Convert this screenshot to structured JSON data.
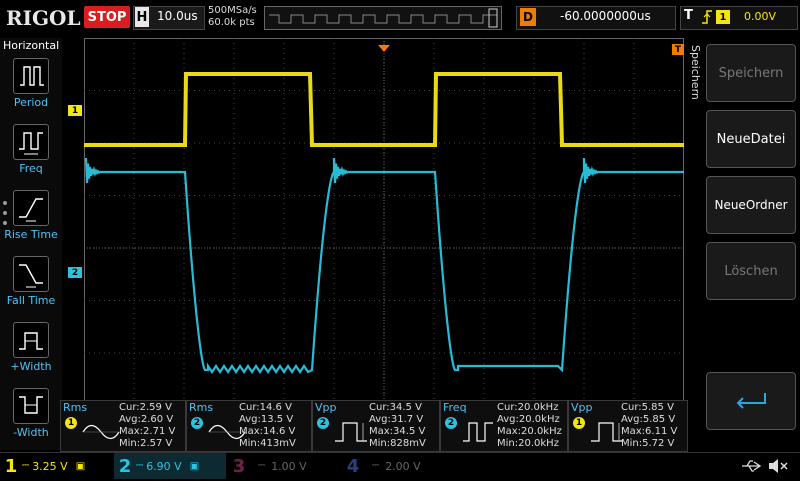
{
  "top": {
    "logo": "RIGOL",
    "run_state": "STOP",
    "horizontal_letter": "H",
    "timebase": "10.0us",
    "sample_rate": "500MSa/s",
    "memory_depth": "60.0k pts",
    "delay_letter": "D",
    "delay": "-60.0000000us",
    "trigger_letter": "T",
    "trigger_source": "1",
    "trigger_level": "0.00V"
  },
  "left_menu": {
    "title": "Horizontal",
    "items": [
      {
        "label": "Period"
      },
      {
        "label": "Freq"
      },
      {
        "label": "Rise Time"
      },
      {
        "label": "Fall Time"
      },
      {
        "label": "+Width"
      },
      {
        "label": "-Width"
      }
    ]
  },
  "right_menu": {
    "title": "Speichern",
    "buttons": [
      "Speichern",
      "NeueDatei",
      "NeueOrdner",
      "Löschen"
    ]
  },
  "markers": {
    "ch1": "1",
    "ch2": "2",
    "trig": "T"
  },
  "measurements": [
    {
      "name": "Rms",
      "channel": "1",
      "stats": "Cur:2.59 V\nAvg:2.60 V\nMax:2.71 V\nMin:2.57 V"
    },
    {
      "name": "Rms",
      "channel": "2",
      "stats": "Cur:14.6 V\nAvg:13.5 V\nMax:14.6 V\nMin:413mV"
    },
    {
      "name": "Vpp",
      "channel": "2",
      "stats": "Cur:34.5 V\nAvg:31.7 V\nMax:34.5 V\nMin:828mV"
    },
    {
      "name": "Freq",
      "channel": "2",
      "stats": "Cur:20.0kHz\nAvg:20.0kHz\nMax:20.0kHz\nMin:20.0kHz"
    },
    {
      "name": "Vpp",
      "channel": "1",
      "stats": "Cur:5.85 V\nAvg:5.85 V\nMax:6.11 V\nMin:5.72 V"
    }
  ],
  "channels": [
    {
      "num": "1",
      "scale": "3.25 V",
      "color": "#f5e612"
    },
    {
      "num": "2",
      "scale": "6.90 V",
      "color": "#29c5e0"
    },
    {
      "num": "3",
      "scale": "1.00 V",
      "color": "#c2317d"
    },
    {
      "num": "4",
      "scale": "2.00 V",
      "color": "#3a5fd0"
    }
  ],
  "colors": {
    "ch1": "#f5e612",
    "ch2": "#29c5e0",
    "accent": "#f07c00"
  }
}
